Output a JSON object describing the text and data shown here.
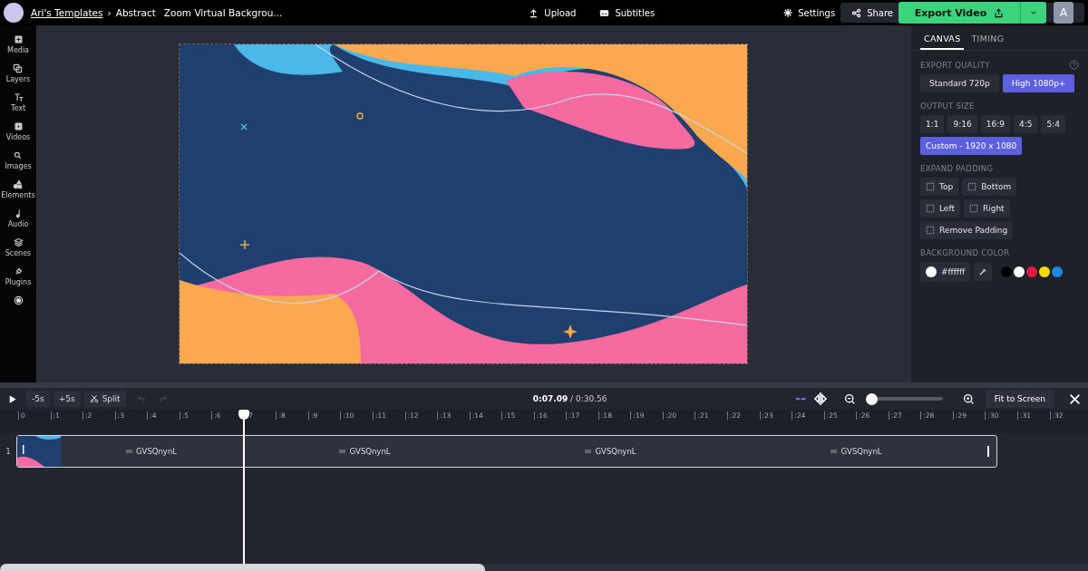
{
  "topbar": {
    "breadcrumb": [
      {
        "label": "Ari's Templates",
        "kind": "link"
      },
      {
        "label": "Abstract",
        "kind": "text"
      }
    ],
    "separator": "›",
    "title": "Zoom Virtual Backgrou...",
    "center_actions": [
      "Upload",
      "Subtitles"
    ],
    "settings": "Settings",
    "share": "Share",
    "export": "Export Video",
    "avatar": "A"
  },
  "sidebar": {
    "items": [
      "Media",
      "Layers",
      "Text",
      "Videos",
      "Images",
      "Elements",
      "Audio",
      "Scenes",
      "Plugins"
    ]
  },
  "panel": {
    "tabs": [
      {
        "label": "CANVAS",
        "selected": true
      },
      {
        "label": "TIMING",
        "selected": false
      }
    ],
    "export_quality": {
      "title": "EXPORT QUALITY",
      "options": [
        {
          "label": "Standard 720p",
          "selected": false
        },
        {
          "label": "High 1080p+",
          "selected": true
        }
      ]
    },
    "output_size": {
      "title": "OUTPUT SIZE",
      "options": [
        {
          "label": "1:1",
          "selected": false
        },
        {
          "label": "9:16",
          "selected": false
        },
        {
          "label": "16:9",
          "selected": false
        },
        {
          "label": "4:5",
          "selected": false
        },
        {
          "label": "5:4",
          "selected": false
        },
        {
          "label": "Custom - 1920 x 1080",
          "selected": true
        }
      ]
    },
    "expand_padding": {
      "title": "EXPAND PADDING",
      "options": [
        "Top",
        "Bottom",
        "Left",
        "Right",
        "Remove Padding"
      ]
    },
    "background_color": {
      "title": "BACKGROUND COLOR",
      "value": "#ffffff",
      "swatches": [
        {
          "color": "#000000"
        },
        {
          "color": "#ffffff"
        },
        {
          "color": "#e8173e"
        },
        {
          "color": "#f5d90a"
        },
        {
          "color": "#1e88e5"
        }
      ]
    }
  },
  "timeline": {
    "controls": [
      "-5s",
      "+5s"
    ],
    "split": "Split",
    "current_time": "0:07.09",
    "total_time": "/ 0:30.56",
    "fit": "Fit to Screen",
    "zoom": {
      "level": 0.04
    },
    "ticks": [
      "0",
      ":1",
      ":2",
      ":3",
      ":4",
      ":5",
      ":6",
      ":7",
      ":8",
      ":9",
      ":10",
      ":11",
      ":12",
      ":13",
      ":14",
      ":15",
      ":16",
      ":17",
      ":18",
      ":19",
      ":20",
      ":21",
      ":22",
      ":23",
      ":24",
      ":25",
      ":26",
      ":27",
      ":28",
      ":29",
      ":30",
      ":31",
      ":32"
    ],
    "playhead": {
      "level": 0.2318
    },
    "tracks": [
      {
        "number": "1",
        "clip_labels": [
          "GVSQnynL",
          "GVSQnynL",
          "GVSQnynL",
          "GVSQnynL"
        ]
      }
    ]
  }
}
